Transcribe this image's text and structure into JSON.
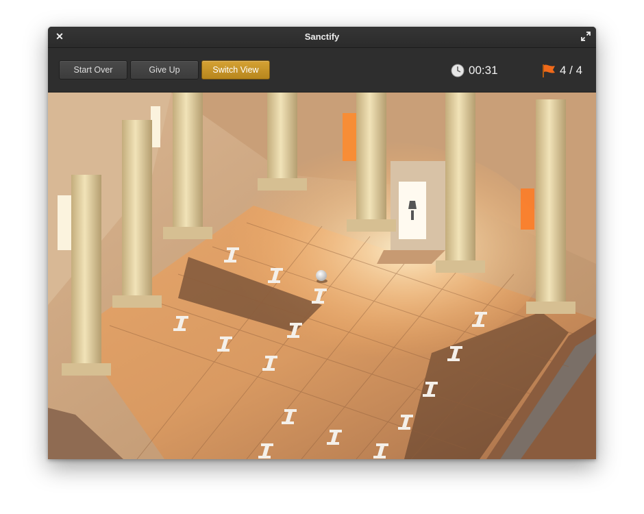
{
  "window": {
    "title": "Sanctify"
  },
  "toolbar": {
    "buttons": [
      {
        "label": "Start Over"
      },
      {
        "label": "Give Up"
      },
      {
        "label": "Switch View"
      }
    ],
    "timer": "00:31",
    "flags": "4 / 4"
  },
  "icons": {
    "close": "close-icon",
    "maximize": "maximize-icon",
    "clock": "clock-icon",
    "flag": "flag-icon"
  },
  "colors": {
    "accent": "#c5961f",
    "flag": "#f06a1a",
    "tile_highlight": "#f0d0a8"
  }
}
